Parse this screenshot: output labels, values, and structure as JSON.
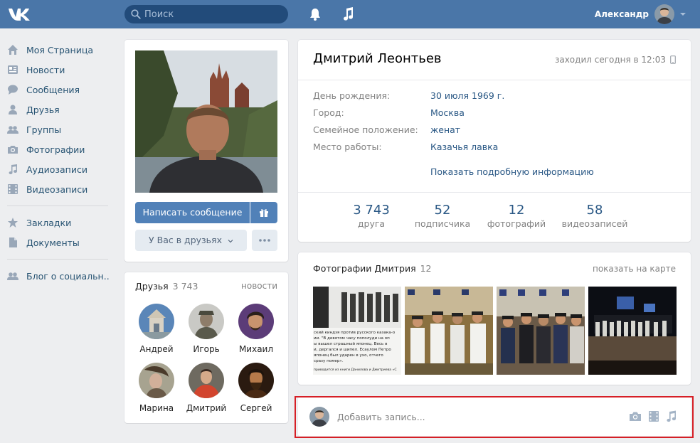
{
  "header": {
    "search_placeholder": "Поиск",
    "user_name": "Александр"
  },
  "sidebar": {
    "items": [
      {
        "label": "Моя Страница",
        "icon": "home-icon"
      },
      {
        "label": "Новости",
        "icon": "news-icon"
      },
      {
        "label": "Сообщения",
        "icon": "messages-icon"
      },
      {
        "label": "Друзья",
        "icon": "friends-icon"
      },
      {
        "label": "Группы",
        "icon": "groups-icon"
      },
      {
        "label": "Фотографии",
        "icon": "camera-icon"
      },
      {
        "label": "Аудиозаписи",
        "icon": "music-icon"
      },
      {
        "label": "Видеозаписи",
        "icon": "video-icon"
      },
      {
        "label": "Закладки",
        "icon": "star-icon"
      },
      {
        "label": "Документы",
        "icon": "document-icon"
      },
      {
        "label": "Блог о социальн..",
        "icon": "community-icon"
      }
    ]
  },
  "profile": {
    "name": "Дмитрий Леонтьев",
    "last_seen": "заходил сегодня в 12:03",
    "message_button": "Написать сообщение",
    "friend_status_button": "У Вас в друзьях",
    "info": [
      {
        "key": "День рождения:",
        "value": "30 июля 1969 г."
      },
      {
        "key": "Город:",
        "value": "Москва"
      },
      {
        "key": "Семейное положение:",
        "value": "женат"
      },
      {
        "key": "Место работы:",
        "value": "Казачья лавка"
      }
    ],
    "show_more": "Показать подробную информацию",
    "stats": [
      {
        "num": "3 743",
        "label": "друга"
      },
      {
        "num": "52",
        "label": "подписчика"
      },
      {
        "num": "12",
        "label": "фотографий"
      },
      {
        "num": "58",
        "label": "видеозаписей"
      }
    ]
  },
  "friends": {
    "title": "Друзья",
    "count": "3 743",
    "news_link": "новости",
    "list": [
      "Андрей",
      "Игорь",
      "Михаил",
      "Марина",
      "Дмитрий",
      "Сергей"
    ]
  },
  "photos": {
    "title": "Фотографии Дмитрия",
    "count": "12",
    "map_link": "показать на карте",
    "clipping_lines": [
      "ский киндзя против русского казака-о",
      "ии. \"В девятом часу пополуди на оп",
      "ы вышел страшный японец. Весь в",
      "и, дергался и шипел. Есаулом Петро",
      "японец был ударен в ухо, отчего",
      "сразу помер».",
      "приводится из книги Данилова и Дмитриева «С"
    ]
  },
  "composer": {
    "placeholder": "Добавить запись..."
  },
  "colors": {
    "header": "#4a76a8",
    "accent_button": "#5181b8",
    "link": "#2a5885",
    "highlight_border": "#d61f26"
  }
}
